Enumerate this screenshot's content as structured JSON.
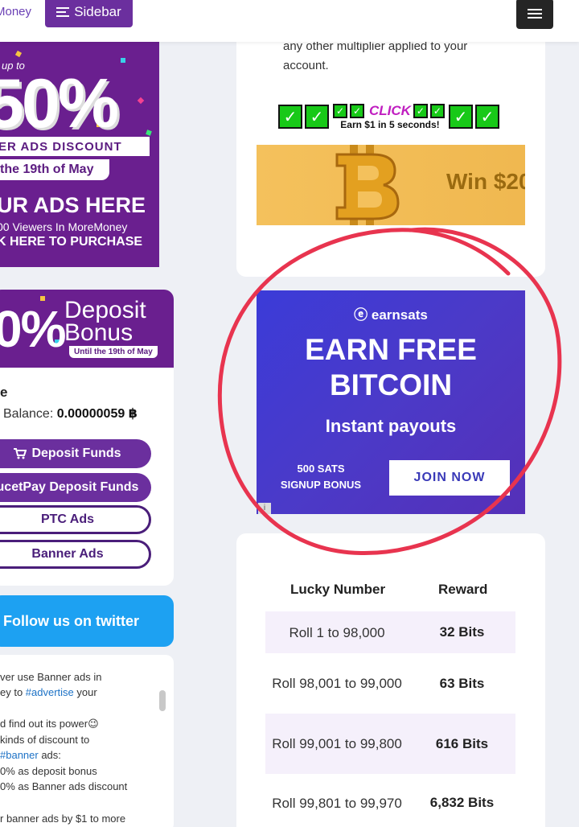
{
  "header": {
    "logo_text": "Money",
    "sidebar_label": "Sidebar"
  },
  "promo_banner": {
    "upto": "up to",
    "percent": "50%",
    "discount": "ER ADS DISCOUNT",
    "date": "the 19th of May",
    "ads_here": "UR ADS HERE",
    "viewers": "00 Viewers In MoreMoney",
    "purchase": "K HERE TO PURCHASE"
  },
  "deposit_banner": {
    "percent": "0%",
    "title": "Deposit\nBonus",
    "until": "Until the 19th of May"
  },
  "user": {
    "name": "e",
    "balance_label": "Balance:",
    "balance_value": "0.00000059 ฿"
  },
  "buttons": {
    "deposit_funds": "Deposit Funds",
    "faucetpay_deposit": "ucetPay Deposit Funds",
    "ptc_ads": "PTC Ads",
    "banner_ads": "Banner Ads",
    "follow_twitter": "Follow us on twitter"
  },
  "tweet": {
    "lines": [
      {
        "text": "ver use Banner ads in",
        "tag": ""
      },
      {
        "text": "ey to ",
        "tag": "#advertise",
        "after": " your"
      },
      {
        "text": "",
        "tag": ""
      },
      {
        "text": "d find out its power😉",
        "tag": ""
      },
      {
        "text": " kinds of discount to",
        "tag": ""
      },
      {
        "text": "",
        "tag": "#banner",
        "after": " ads:"
      },
      {
        "text": "0% as deposit bonus",
        "tag": ""
      },
      {
        "text": "0% as Banner ads discount",
        "tag": ""
      },
      {
        "text": "",
        "tag": ""
      },
      {
        "text": "r banner ads by $1 to more",
        "tag": ""
      }
    ]
  },
  "main_top": {
    "multiplier_text": "any other multiplier applied to your account.",
    "click_word": "CLICK",
    "click_sub": "Earn $1 in 5 seconds!",
    "win_text": "Win $20"
  },
  "earnsats_ad": {
    "logo": "earnsats",
    "headline": "EARN FREE\nBITCOIN",
    "subline": "Instant payouts",
    "bonus": "500 SATS\nSIGNUP BONUS",
    "join": "JOIN NOW",
    "info": "i"
  },
  "reward_table": {
    "col_number": "Lucky Number",
    "col_reward": "Reward",
    "rows": [
      {
        "number": "Roll 1 to 98,000",
        "reward": "32 Bits"
      },
      {
        "number": "Roll 98,001 to 99,000",
        "reward": "63 Bits"
      },
      {
        "number": "Roll 99,001 to 99,800",
        "reward": "616 Bits"
      },
      {
        "number": "Roll 99,801 to 99,970",
        "reward": "6,832 Bits"
      }
    ]
  },
  "colors": {
    "brand_purple": "#6b2f9e",
    "twitter_blue": "#1da1f2",
    "annotation_red": "#e8344f",
    "ad_blue": "#3b3bd8"
  }
}
